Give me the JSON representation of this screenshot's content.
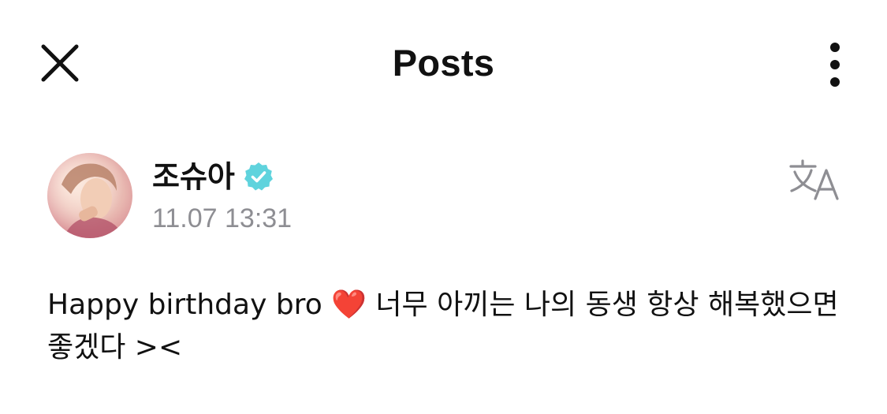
{
  "header": {
    "title": "Posts",
    "close_icon": "close-icon",
    "more_icon": "more-vertical-icon"
  },
  "post": {
    "author": {
      "name": "조슈아",
      "verified_icon": "verified-badge-icon",
      "verified_color": "#5fd3dd",
      "avatar_icon": "avatar"
    },
    "timestamp": "11.07 13:31",
    "translate_icon": "translate-icon",
    "text": "Happy birthday bro ❤️ 너무 아끼는 나의 동생 항상 해복했으면 좋겠다 ><"
  }
}
